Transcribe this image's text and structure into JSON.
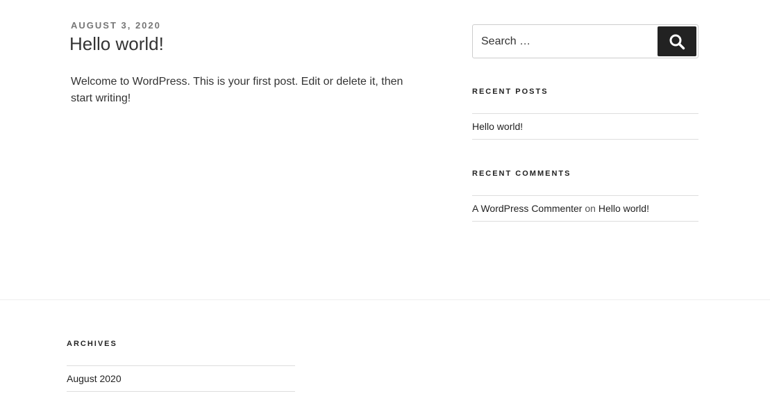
{
  "post": {
    "date": "AUGUST 3, 2020",
    "title": "Hello world!",
    "content": "Welcome to WordPress. This is your first post. Edit or delete it, then start writing!"
  },
  "search": {
    "placeholder": "Search …",
    "button_label": "Search",
    "icon": "search-icon"
  },
  "recent_posts": {
    "title": "RECENT POSTS",
    "items": [
      {
        "label": "Hello world!"
      }
    ]
  },
  "recent_comments": {
    "title": "RECENT COMMENTS",
    "items": [
      {
        "author": "A WordPress Commenter",
        "separator": "on",
        "post": "Hello world!"
      }
    ]
  },
  "archives": {
    "title": "ARCHIVES",
    "items": [
      {
        "label": "August 2020"
      }
    ]
  },
  "colors": {
    "text": "#333333",
    "meta": "#767676",
    "button_bg": "#222222",
    "border": "#dddddd"
  }
}
